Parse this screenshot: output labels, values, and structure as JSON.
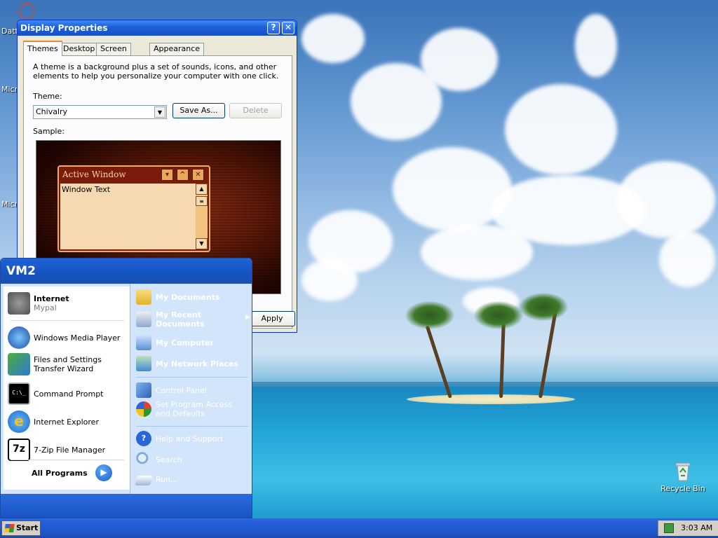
{
  "desktop": {
    "icons": [
      {
        "label": "Datt",
        "icon": "gear-icon"
      },
      {
        "label": "Micr",
        "icon": "document-icon"
      },
      {
        "label": "Micr",
        "icon": "document-icon"
      },
      {
        "label": "Recycle Bin",
        "icon": "recycle-bin-icon"
      }
    ]
  },
  "dialog": {
    "title": "Display Properties",
    "help_btn": "?",
    "close_btn": "✕",
    "tabs": [
      "Themes",
      "Desktop",
      "Screen Saver",
      "Appearance"
    ],
    "description": "A theme is a background plus a set of sounds, icons, and other elements to help you personalize your computer with one click.",
    "theme_label": "Theme:",
    "theme_value": "Chivalry",
    "save_as": "Save As...",
    "delete": "Delete",
    "sample_label": "Sample:",
    "apply": "Apply",
    "sample_window": {
      "title": "Active Window",
      "body": "Window Text"
    }
  },
  "start_menu": {
    "user": "VM2",
    "pinned": [
      {
        "title": "Internet",
        "subtitle": "Mypal",
        "icon": "raccoon-icon"
      }
    ],
    "recent": [
      {
        "title": "Windows Media Player",
        "icon": "media-player-icon"
      },
      {
        "title": "Files and Settings Transfer Wizard",
        "icon": "transfer-wizard-icon"
      },
      {
        "title": "Command Prompt",
        "icon": "command-prompt-icon"
      },
      {
        "title": "Internet Explorer",
        "icon": "internet-explorer-icon"
      },
      {
        "title": "7-Zip File Manager",
        "icon": "7zip-icon"
      }
    ],
    "all_programs": "All Programs",
    "places": [
      {
        "title": "My Documents",
        "bold": true,
        "icon": "folder-icon"
      },
      {
        "title": "My Recent Documents",
        "bold": true,
        "icon": "recent-documents-icon"
      },
      {
        "title": "My Computer",
        "bold": true,
        "icon": "computer-icon"
      },
      {
        "title": "My Network Places",
        "bold": true,
        "icon": "network-icon"
      },
      {
        "title": "Control Panel",
        "bold": false,
        "icon": "control-panel-icon"
      },
      {
        "title": "Set Program Access and Defaults",
        "bold": false,
        "icon": "program-access-icon"
      },
      {
        "title": "Help and Support",
        "bold": false,
        "icon": "help-icon"
      },
      {
        "title": "Search",
        "bold": false,
        "icon": "search-icon"
      },
      {
        "title": "Run...",
        "bold": false,
        "icon": "run-icon"
      }
    ]
  },
  "taskbar": {
    "start_label": "Start",
    "clock": "3:03 AM"
  }
}
